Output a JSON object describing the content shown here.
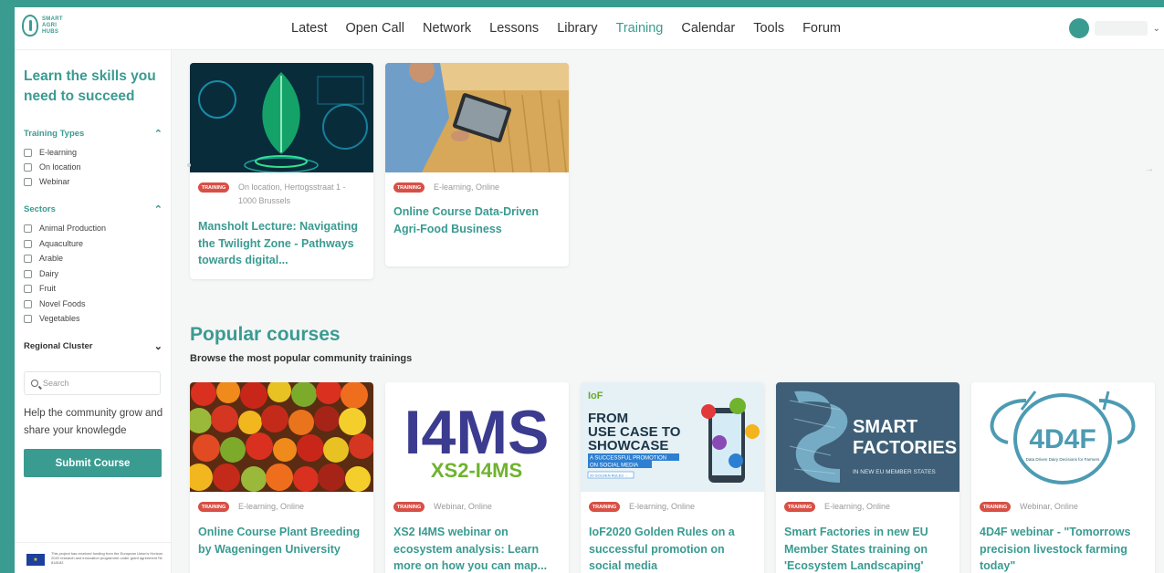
{
  "brand": {
    "logo_text": "SMART\nAGRI\nHUBS"
  },
  "nav": [
    "Latest",
    "Open Call",
    "Network",
    "Lessons",
    "Library",
    "Training",
    "Calendar",
    "Tools",
    "Forum"
  ],
  "nav_active": "Training",
  "sidebar": {
    "title": "Learn the skills you need to succeed",
    "training_types": {
      "label": "Training Types",
      "items": [
        "E-learning",
        "On location",
        "Webinar"
      ]
    },
    "sectors": {
      "label": "Sectors",
      "items": [
        "Animal Production",
        "Aquaculture",
        "Arable",
        "Dairy",
        "Fruit",
        "Novel Foods",
        "Vegetables"
      ]
    },
    "regional": {
      "label": "Regional Cluster"
    },
    "search_placeholder": "Search",
    "help_text": "Help the community grow and share your knowlegde",
    "submit_label": "Submit Course",
    "eu_text": "This project has received funding from the European Union's Horizon 2020 research and innovation programme under grant agreement № 818182."
  },
  "featured": [
    {
      "badge": "TRAINING",
      "meta": "On location, Hertogsstraat 1 - 1000 Brussels",
      "title": "Mansholt Lecture: Navigating the Twilight Zone - Pathways towards digital..."
    },
    {
      "badge": "TRAINING",
      "meta": "E-learning, Online",
      "title": "Online Course Data-Driven Agri-Food Business"
    }
  ],
  "popular": {
    "title": "Popular courses",
    "subtitle": "Browse the most popular community trainings",
    "cards": [
      {
        "badge": "TRAINING",
        "meta": "E-learning, Online",
        "title": "Online Course Plant Breeding by Wageningen University"
      },
      {
        "badge": "TRAINING",
        "meta": "Webinar, Online",
        "title": "XS2 I4MS webinar on ecosystem analysis: Learn more on how you can map..."
      },
      {
        "badge": "TRAINING",
        "meta": "E-learning, Online",
        "title": "IoF2020 Golden Rules on a successful promotion on social media"
      },
      {
        "badge": "TRAINING",
        "meta": "E-learning, Online",
        "title": "Smart Factories in new EU Member States training on 'Ecosystem Landscaping'"
      },
      {
        "badge": "TRAINING",
        "meta": "Webinar, Online",
        "title": "4D4F webinar - \"Tomorrows precision livestock farming today\""
      }
    ]
  },
  "image_text": {
    "i4ms_line1": "I4MS",
    "i4ms_line2": "XS2-I4MS",
    "iof_logo": "IoF",
    "iof_h1": "FROM",
    "iof_h2": "USE CASE TO",
    "iof_h3": "SHOWCASE",
    "iof_sub1": "A SUCCESSFUL PROMOTION",
    "iof_sub2": "ON SOCIAL MEDIA",
    "iof_tag": "20 GOLDEN RULES →",
    "sf_line1": "SMART",
    "sf_line2": "FACTORIES",
    "sf_line3": "IN NEW EU MEMBER STATES",
    "d4_logo": "4D4F",
    "d4_sub": "Data Driven Dairy Decisions for Farmers"
  },
  "colors": {
    "accent": "#3a9b91",
    "badge": "#d84f45"
  }
}
